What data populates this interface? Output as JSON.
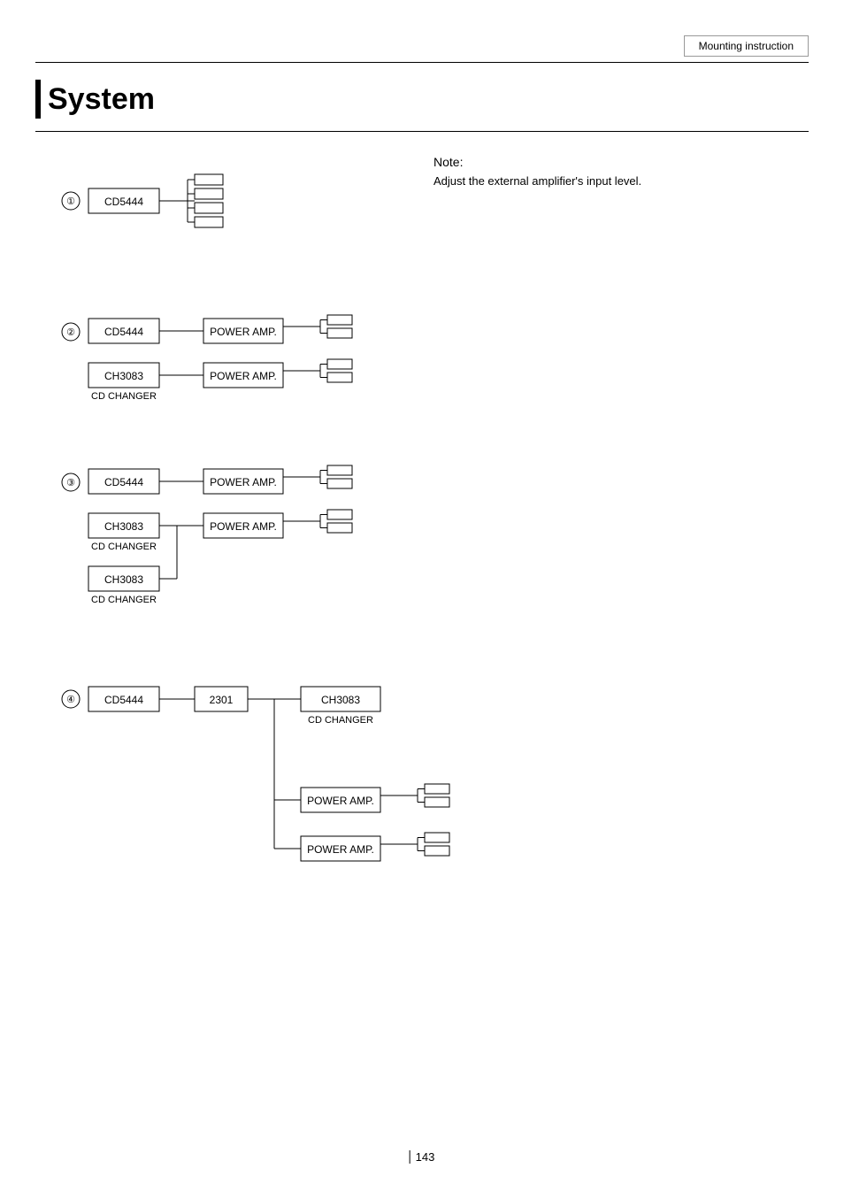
{
  "header": {
    "title": "Mounting instruction"
  },
  "page": {
    "title": "System",
    "number": "143"
  },
  "note": {
    "title": "Note:",
    "text": "Adjust the external\namplifier's input level."
  },
  "diagrams": {
    "d1": {
      "number": "①",
      "cd": "CD5444"
    },
    "d2": {
      "number": "②",
      "cd": "CD5444",
      "ch": "CH3083",
      "cd_changer": "CD CHANGER",
      "amp1": "POWER AMP.",
      "amp2": "POWER AMP."
    },
    "d3": {
      "number": "③",
      "cd": "CD5444",
      "ch1": "CH3083",
      "cd_changer1": "CD CHANGER",
      "ch2": "CH3083",
      "cd_changer2": "CD CHANGER",
      "amp1": "POWER AMP.",
      "amp2": "POWER AMP."
    },
    "d4": {
      "number": "④",
      "cd": "CD5444",
      "hub": "2301",
      "ch": "CH3083",
      "cd_changer": "CD CHANGER",
      "amp1": "POWER AMP.",
      "amp2": "POWER AMP."
    }
  }
}
